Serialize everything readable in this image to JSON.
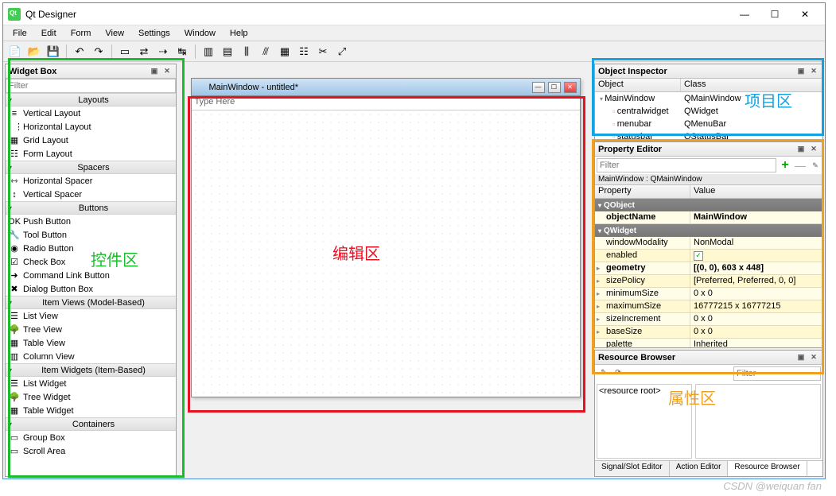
{
  "app_title": "Qt Designer",
  "menus": [
    "File",
    "Edit",
    "Form",
    "View",
    "Settings",
    "Window",
    "Help"
  ],
  "widgetbox": {
    "title": "Widget Box",
    "filter_placeholder": "Filter",
    "categories": [
      {
        "name": "Layouts",
        "items": [
          "Vertical Layout",
          "Horizontal Layout",
          "Grid Layout",
          "Form Layout"
        ]
      },
      {
        "name": "Spacers",
        "items": [
          "Horizontal Spacer",
          "Vertical Spacer"
        ]
      },
      {
        "name": "Buttons",
        "items": [
          "Push Button",
          "Tool Button",
          "Radio Button",
          "Check Box",
          "Command Link Button",
          "Dialog Button Box"
        ]
      },
      {
        "name": "Item Views (Model-Based)",
        "items": [
          "List View",
          "Tree View",
          "Table View",
          "Column View"
        ]
      },
      {
        "name": "Item Widgets (Item-Based)",
        "items": [
          "List Widget",
          "Tree Widget",
          "Table Widget"
        ]
      },
      {
        "name": "Containers",
        "items": [
          "Group Box",
          "Scroll Area"
        ]
      }
    ]
  },
  "mdi": {
    "title": "MainWindow - untitled*",
    "type_here": "Type Here"
  },
  "inspector": {
    "title": "Object Inspector",
    "cols": [
      "Object",
      "Class"
    ],
    "rows": [
      {
        "obj": "MainWindow",
        "cls": "QMainWindow",
        "indent": 0
      },
      {
        "obj": "centralwidget",
        "cls": "QWidget",
        "indent": 1
      },
      {
        "obj": "menubar",
        "cls": "QMenuBar",
        "indent": 1
      },
      {
        "obj": "statusbar",
        "cls": "QStatusBar",
        "indent": 1
      }
    ]
  },
  "property": {
    "title": "Property Editor",
    "filter_placeholder": "Filter",
    "scope": "MainWindow : QMainWindow",
    "cols": [
      "Property",
      "Value"
    ],
    "groups": [
      {
        "name": "QObject",
        "props": [
          {
            "k": "objectName",
            "v": "MainWindow",
            "bold": true
          }
        ]
      },
      {
        "name": "QWidget",
        "props": [
          {
            "k": "windowModality",
            "v": "NonModal"
          },
          {
            "k": "enabled",
            "v": "__check__"
          },
          {
            "k": "geometry",
            "v": "[(0, 0), 603 x 448]",
            "bold": true,
            "exp": true
          },
          {
            "k": "sizePolicy",
            "v": "[Preferred, Preferred, 0, 0]",
            "exp": true
          },
          {
            "k": "minimumSize",
            "v": "0 x 0",
            "exp": true
          },
          {
            "k": "maximumSize",
            "v": "16777215 x 16777215",
            "exp": true
          },
          {
            "k": "sizeIncrement",
            "v": "0 x 0",
            "exp": true
          },
          {
            "k": "baseSize",
            "v": "0 x 0",
            "exp": true
          },
          {
            "k": "palette",
            "v": "Inherited"
          }
        ]
      }
    ]
  },
  "resource": {
    "title": "Resource Browser",
    "filter_placeholder": "Filter",
    "root": "<resource root>",
    "tabs": [
      "Signal/Slot Editor",
      "Action Editor",
      "Resource Browser"
    ],
    "active": 2
  },
  "annotations": {
    "left": "控件区",
    "center": "编辑区",
    "top_right": "项目区",
    "bottom_right": "属性区"
  },
  "watermark": "CSDN @weiquan fan"
}
